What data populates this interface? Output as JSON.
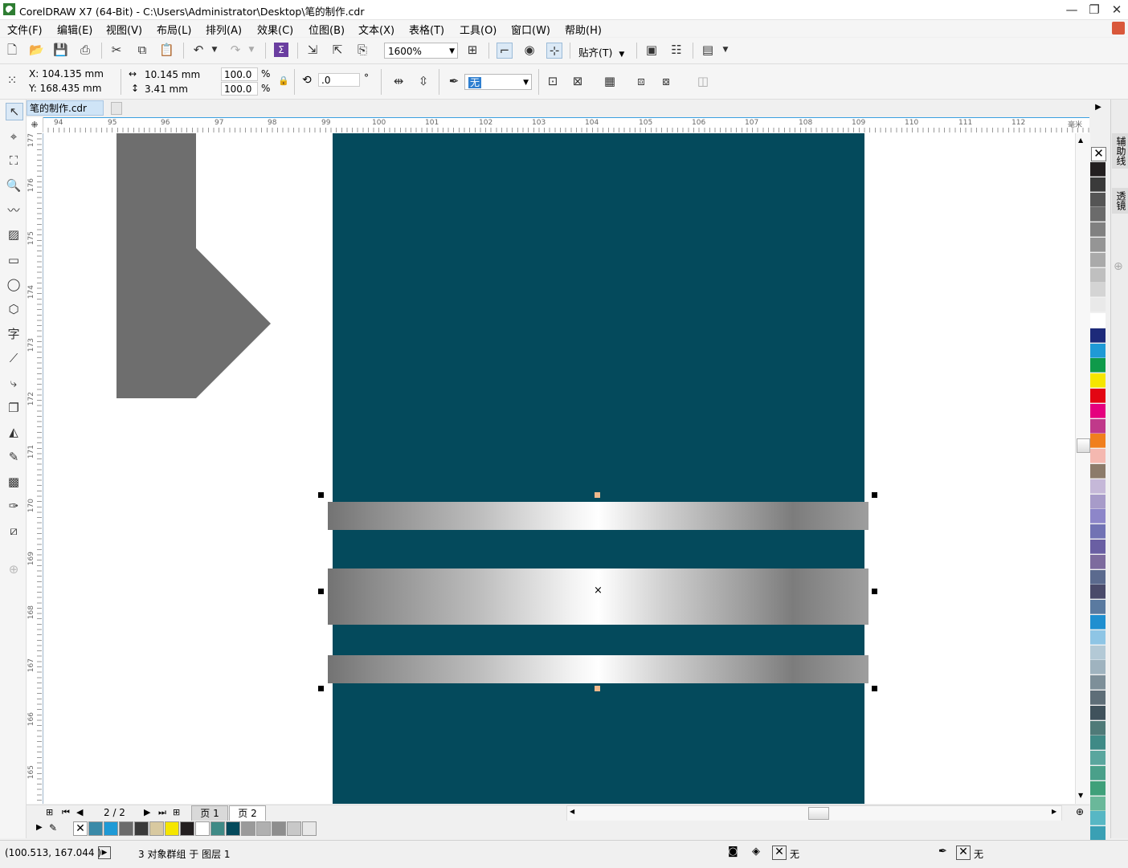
{
  "window": {
    "title": "CorelDRAW X7 (64-Bit) - C:\\Users\\Administrator\\Desktop\\笔的制作.cdr",
    "minimize": "—",
    "maximize": "❐",
    "close": "✕"
  },
  "menu": [
    "文件(F)",
    "编辑(E)",
    "视图(V)",
    "布局(L)",
    "排列(A)",
    "效果(C)",
    "位图(B)",
    "文本(X)",
    "表格(T)",
    "工具(O)",
    "窗口(W)",
    "帮助(H)"
  ],
  "toolbar": {
    "zoom": "1600%",
    "snap_label": "贴齐(T)"
  },
  "properties": {
    "x": "X: 104.135 mm",
    "y": "Y: 168.435 mm",
    "width": "10.145 mm",
    "height": "3.41 mm",
    "scale_w": "100.0",
    "scale_h": "100.0",
    "percent": "%",
    "rotation": ".0",
    "degree": "°",
    "outline": "无"
  },
  "document_tab": "笔的制作.cdr",
  "rulers": {
    "h_labels": [
      "94",
      "95",
      "96",
      "97",
      "98",
      "99",
      "100",
      "101",
      "102",
      "103",
      "104",
      "105",
      "106",
      "107",
      "108",
      "109",
      "110",
      "111",
      "112"
    ],
    "h_unit": "毫米",
    "v_labels": [
      "177",
      "176",
      "175",
      "174",
      "173",
      "172",
      "171",
      "170",
      "169",
      "168",
      "167",
      "166",
      "165"
    ]
  },
  "page_nav": {
    "counter": "2 / 2",
    "page1": "页 1",
    "page2": "页 2"
  },
  "status": {
    "coords": "(100.513, 167.044 )",
    "selection": "3 对象群组 于 图层 1",
    "fill": "无",
    "outline": "无"
  },
  "dockers": {
    "tab1": "辅助线",
    "tab2": "透镜"
  },
  "colors": {
    "accent": "#3aa0e0",
    "page_rect": "#044a5c",
    "shape_gray": "#6e6e6e"
  },
  "bottom_palette": [
    "none",
    "#3a8aa8",
    "#1f9ad6",
    "#6b6b6b",
    "#3a3a3a",
    "#d8c9a0",
    "#f5e600",
    "#231f20",
    "#ffffff",
    "#3f8a86",
    "#044a5c",
    "#9a9a9a",
    "#b0b0b0",
    "#8e8e8e",
    "#c8c8c8",
    "#e8e8e8"
  ],
  "right_palette": [
    "#231f20",
    "#3a3a3a",
    "#555",
    "#6b6b6b",
    "#808080",
    "#959595",
    "#aaaaaa",
    "#bfbfbf",
    "#d4d4d4",
    "#e9e9e9",
    "#ffffff",
    "#1d2a7a",
    "#1f9ad6",
    "#0f9a4a",
    "#f5e600",
    "#e30613",
    "#e5007e",
    "#c0398a",
    "#f07f1e",
    "#f4b8b0",
    "#8c7b6a",
    "#c5b8d8",
    "#a79bc9",
    "#8d86c9",
    "#7172b4",
    "#6a5fa3",
    "#7d6b9e",
    "#5b6a8e",
    "#4a4a6a",
    "#5a7aa0",
    "#1f8fd0",
    "#8ec5e5",
    "#b3c9d6",
    "#9fb3bf",
    "#7d8f99",
    "#5e6e78",
    "#40525c",
    "#4f7a78",
    "#3f8a86",
    "#5aa69e",
    "#4aa08a",
    "#3fa07a",
    "#6ab89a",
    "#57b7c4",
    "#3aa0b4"
  ]
}
